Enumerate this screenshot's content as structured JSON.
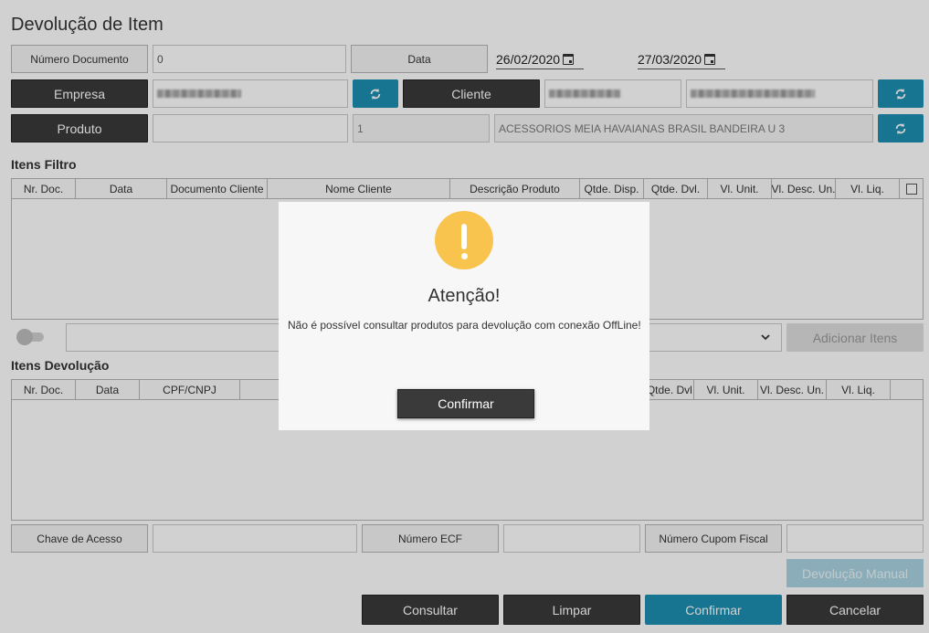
{
  "page": {
    "title": "Devolução de Item"
  },
  "filters": {
    "numero_documento_label": "Número Documento",
    "numero_documento_value": "0",
    "data_label": "Data",
    "date_from": "26/02/2020",
    "date_to": "27/03/2020",
    "empresa_label": "Empresa",
    "cliente_label": "Cliente",
    "produto_label": "Produto",
    "produto_code": "",
    "produto_qty": "1",
    "produto_desc": "ACESSORIOS MEIA HAVAIANAS BRASIL BANDEIRA U 3"
  },
  "itens_filtro": {
    "title": "Itens Filtro",
    "columns": [
      "Nr. Doc.",
      "Data",
      "Documento Cliente",
      "Nome Cliente",
      "Descrição Produto",
      "Qtde. Disp.",
      "Qtde. Dvl.",
      "Vl. Unit.",
      "Vl. Desc. Un.",
      "Vl. Liq."
    ]
  },
  "mid_bar": {
    "select_value": "",
    "add_button": "Adicionar Itens"
  },
  "itens_devolucao": {
    "title": "Itens Devolução",
    "columns_left": [
      "Nr. Doc.",
      "Data",
      "CPF/CNPJ"
    ],
    "columns_right": [
      "Qtde. Dvl.",
      "Vl. Unit.",
      "Vl. Desc. Un.",
      "Vl. Liq."
    ]
  },
  "bottom_fields": {
    "chave_label": "Chave de Acesso",
    "chave_value": "",
    "ecf_label": "Número ECF",
    "ecf_value": "",
    "cupom_label": "Número Cupom Fiscal",
    "cupom_value": ""
  },
  "actions": {
    "devolucao_manual": "Devolução Manual",
    "consultar": "Consultar",
    "limpar": "Limpar",
    "confirmar": "Confirmar",
    "cancelar": "Cancelar"
  },
  "dialog": {
    "title": "Atenção!",
    "message": "Não é possível consultar produtos para devolução com conexão OffLine!",
    "confirm_button": "Confirmar"
  },
  "colors": {
    "accent": "#1d8fb1",
    "dark_button": "#3a3a3a",
    "warning": "#f8c44e"
  },
  "icons": {
    "refresh": "refresh-icon",
    "calendar": "calendar-icon",
    "warning": "warning-icon",
    "dropdown": "chevron-down-icon"
  }
}
